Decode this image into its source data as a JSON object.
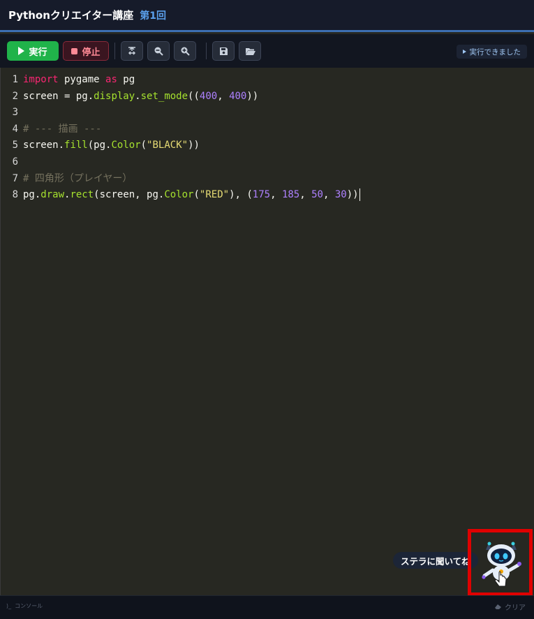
{
  "header": {
    "title": "Pythonクリエイター講座",
    "lesson": "第1回"
  },
  "toolbar": {
    "run_label": "実行",
    "stop_label": "停止",
    "icons": [
      "format-icon",
      "zoom-out-icon",
      "zoom-in-icon",
      "save-icon",
      "open-folder-icon"
    ],
    "status_text": "実行できました"
  },
  "editor": {
    "lines": [
      {
        "n": "1"
      },
      {
        "n": "2"
      },
      {
        "n": "3"
      },
      {
        "n": "4"
      },
      {
        "n": "5"
      },
      {
        "n": "6"
      },
      {
        "n": "7"
      },
      {
        "n": "8"
      }
    ],
    "code": {
      "l1": {
        "kw1": "import",
        "t1": " pygame ",
        "kw2": "as",
        "t2": " pg"
      },
      "l2": {
        "t1": "screen = pg.",
        "f1": "display",
        "t2": ".",
        "f2": "set_mode",
        "t3": "((",
        "n1": "400",
        "t4": ", ",
        "n2": "400",
        "t5": "))"
      },
      "l4": {
        "c": "# --- 描画 ---"
      },
      "l5": {
        "t1": "screen.",
        "f1": "fill",
        "t2": "(pg.",
        "f2": "Color",
        "t3": "(",
        "s1": "\"BLACK\"",
        "t4": "))"
      },
      "l7": {
        "c": "# 四角形（プレイヤー）"
      },
      "l8": {
        "t1": "pg.",
        "f1": "draw",
        "t2": ".",
        "f2": "rect",
        "t3": "(screen, pg.",
        "f3": "Color",
        "t4": "(",
        "s1": "\"RED\"",
        "t5": "), (",
        "n1": "175",
        "t6": ", ",
        "n2": "185",
        "t7": ", ",
        "n3": "50",
        "t8": ", ",
        "n4": "30",
        "t9": "))"
      }
    }
  },
  "assistant": {
    "tooltip": "ステラに聞いてね"
  },
  "footer": {
    "console_label": "コンソール",
    "clear_label": "クリア"
  },
  "colors": {
    "accent": "#3d6fb2",
    "run": "#20b34a",
    "stop": "#ff8a96",
    "highlight_frame": "#e00000"
  }
}
